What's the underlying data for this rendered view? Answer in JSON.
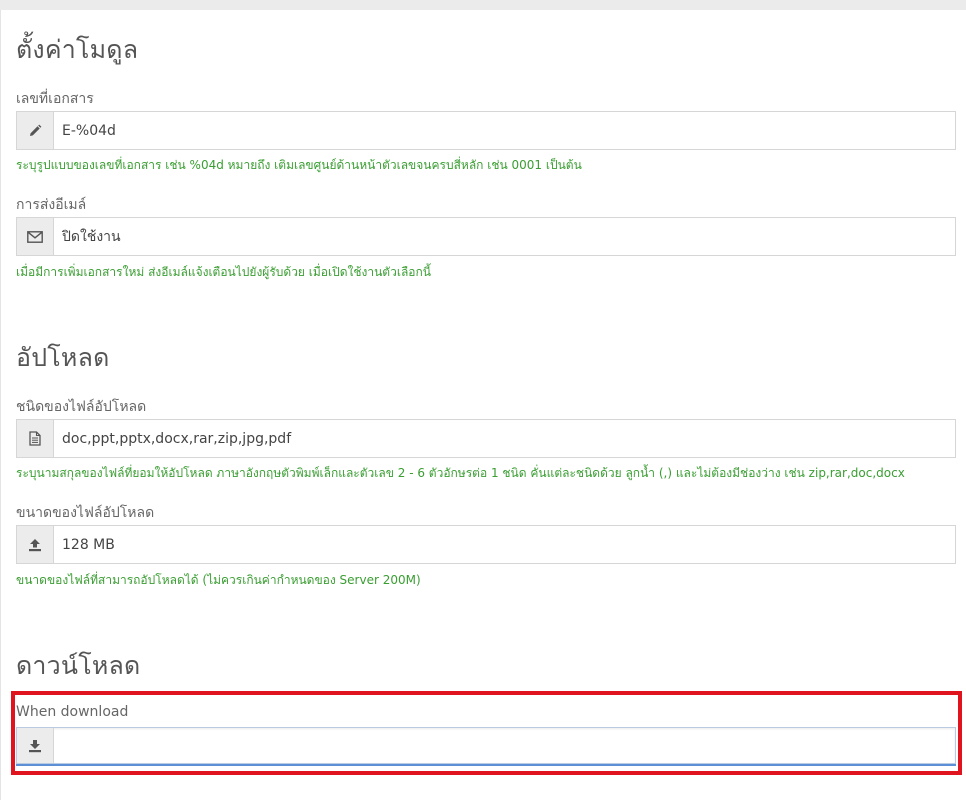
{
  "module_settings": {
    "title": "ตั้งค่าโมดูล",
    "doc_number": {
      "label": "เลขที่เอกสาร",
      "icon": "pencil-icon",
      "value": "E-%04d",
      "hint": "ระบุรูปแบบของเลขที่เอกสาร เช่น %04d หมายถึง เติมเลขศูนย์ด้านหน้าตัวเลขจนครบสี่หลัก เช่น 0001 เป็นต้น"
    },
    "email": {
      "label": "การส่งอีเมล์",
      "icon": "envelope-icon",
      "value": "ปิดใช้งาน",
      "hint": "เมื่อมีการเพิ่มเอกสารใหม่ ส่งอีเมล์แจ้งเตือนไปยังผู้รับด้วย เมื่อเปิดใช้งานตัวเลือกนี้"
    }
  },
  "upload": {
    "title": "อัปโหลด",
    "file_types": {
      "label": "ชนิดของไฟล์อัปโหลด",
      "icon": "file-icon",
      "value": "doc,ppt,pptx,docx,rar,zip,jpg,pdf",
      "hint": "ระบุนามสกุลของไฟล์ที่ยอมให้อัปโหลด ภาษาอังกฤษตัวพิมพ์เล็กและตัวเลข 2 - 6 ตัวอักษรต่อ 1 ชนิด คั่นแต่ละชนิดด้วย ลูกน้ำ (,) และไม่ต้องมีช่องว่าง เช่น zip,rar,doc,docx"
    },
    "file_size": {
      "label": "ขนาดของไฟล์อัปโหลด",
      "icon": "upload-icon",
      "value": "128 MB",
      "hint": "ขนาดของไฟล์ที่สามารถอัปโหลดได้ (ไม่ควรเกินค่ากำหนดของ Server 200M)"
    }
  },
  "download": {
    "title": "ดาวน์โหลด",
    "when_download": {
      "label": "When download",
      "icon": "download-icon",
      "value": ""
    }
  },
  "colors": {
    "hint_green": "#3a9e32",
    "highlight_red": "#e0141e",
    "focus_blue": "#5c8fd6"
  }
}
